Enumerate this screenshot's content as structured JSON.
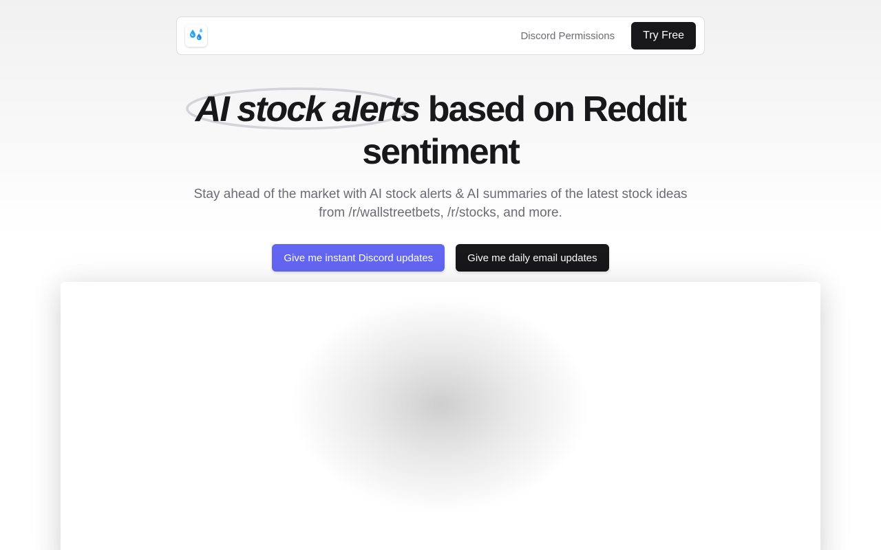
{
  "nav": {
    "logo_icon": "sweat-droplets-icon",
    "links": [
      {
        "label": "Discord Permissions"
      }
    ],
    "cta_label": "Try Free"
  },
  "hero": {
    "title_highlight": "AI stock alerts",
    "title_rest": " based on Reddit sentiment",
    "subtitle": "Stay ahead of the market with AI stock alerts & AI summaries of the latest stock ideas from /r/wallstreetbets, /r/stocks, and more.",
    "buttons": {
      "discord_label": "Give me instant Discord updates",
      "email_label": "Give me daily email updates"
    }
  },
  "colors": {
    "accent": "#6366f1",
    "dark": "#18181b",
    "muted_text": "#6b6b73",
    "logo_blue": "#1ea1f2"
  }
}
